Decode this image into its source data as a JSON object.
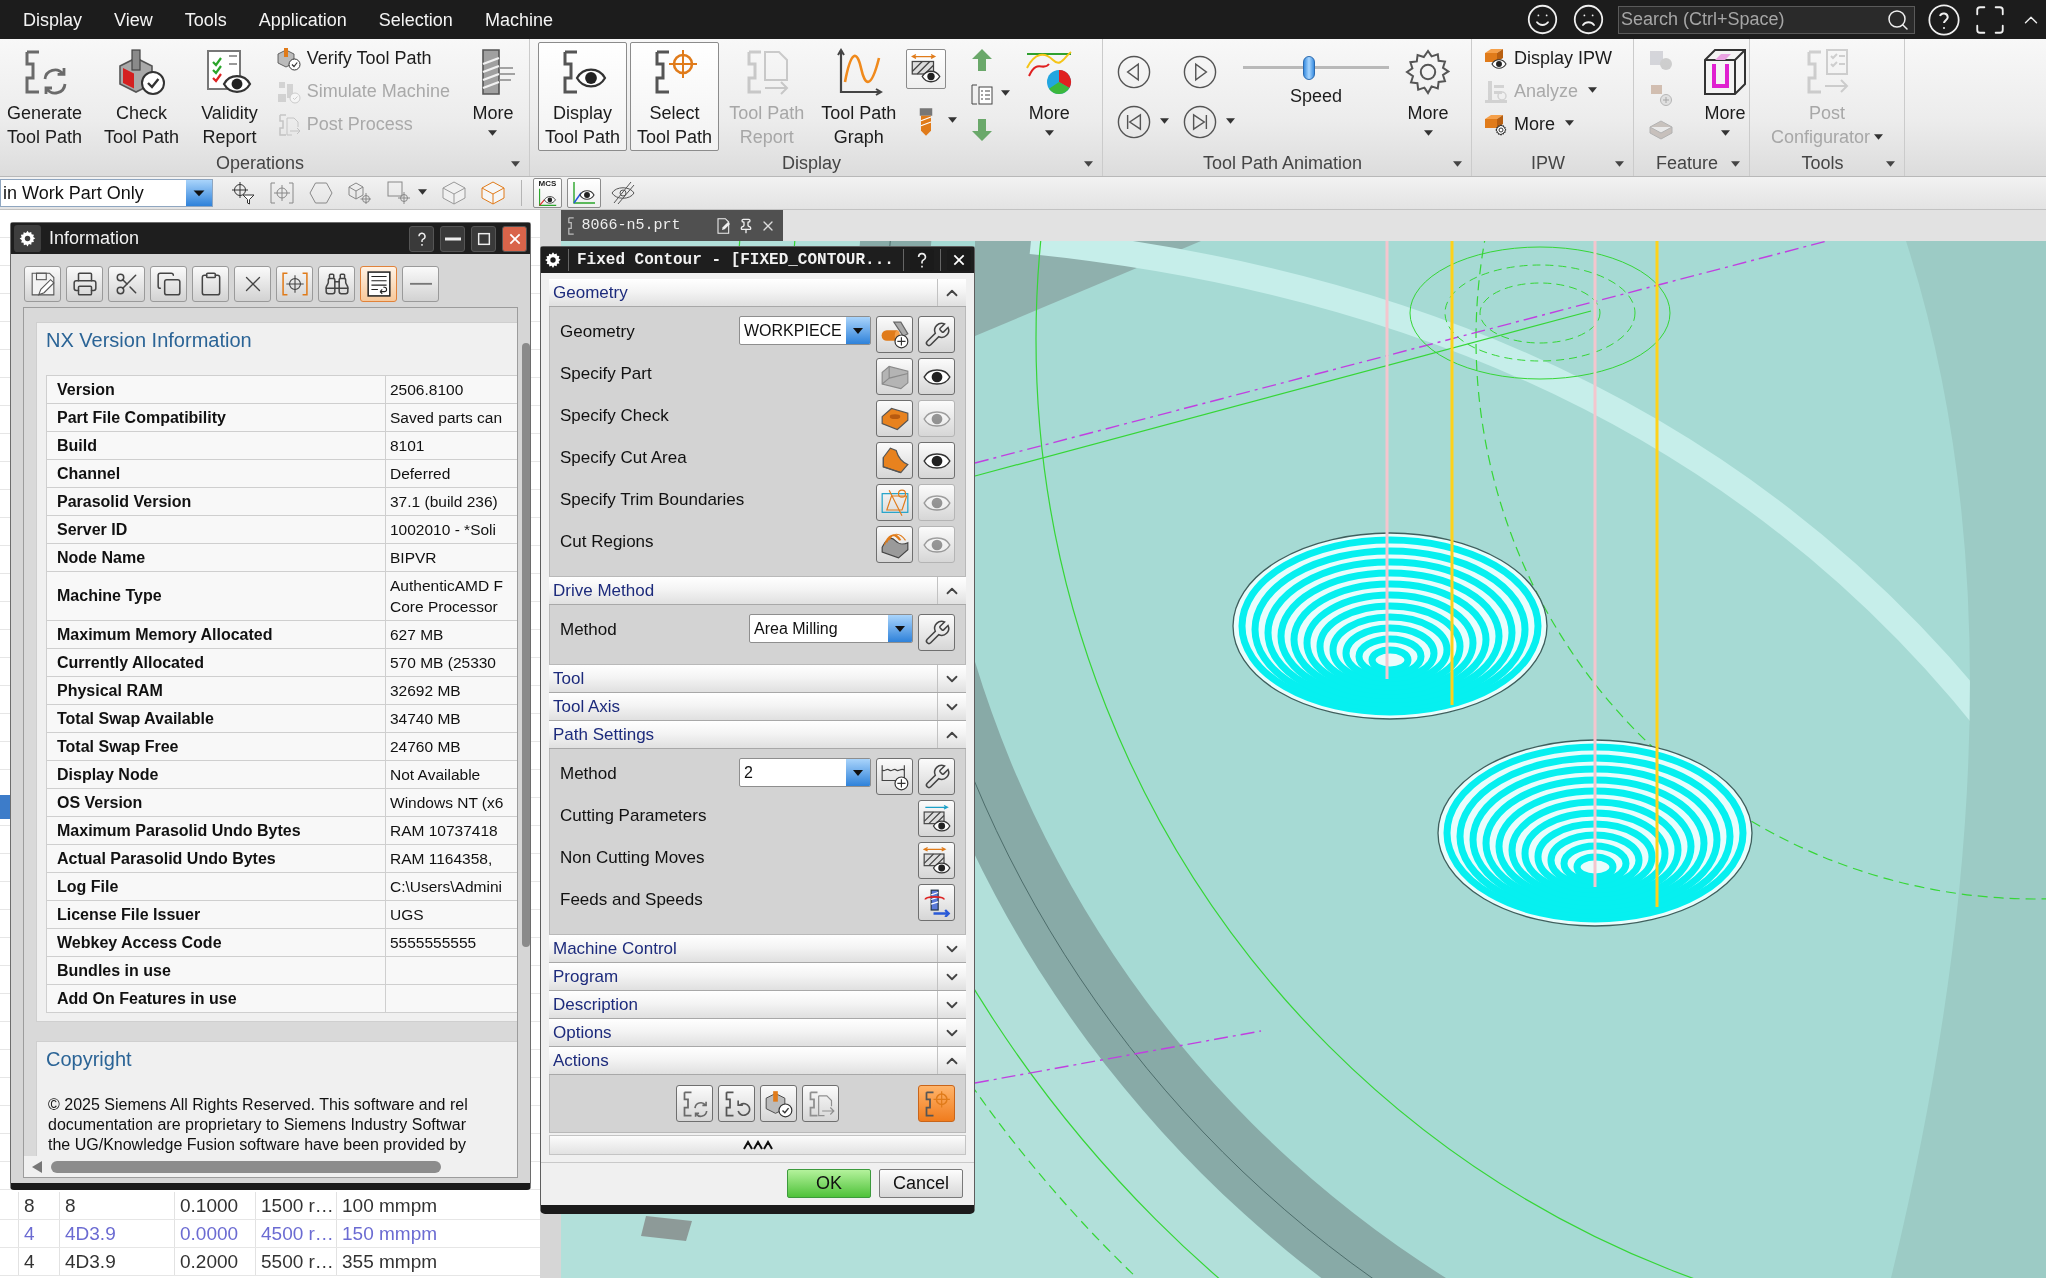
{
  "menu_bar": {
    "items": [
      "Display",
      "View",
      "Tools",
      "Application",
      "Selection",
      "Machine"
    ],
    "search": {
      "placeholder": "Search (Ctrl+Space)"
    }
  },
  "ribbon": {
    "groups": [
      {
        "label": "Operations",
        "items": [
          {
            "kind": "large",
            "label": "Generate\nTool Path",
            "disabled": false,
            "selected": false,
            "dropdown": false
          },
          {
            "kind": "large",
            "label": "Check\nTool Path",
            "disabled": false,
            "selected": false,
            "dropdown": false
          },
          {
            "kind": "large",
            "label": "Validity\nReport",
            "disabled": false,
            "selected": false,
            "dropdown": false
          },
          {
            "kind": "stack",
            "entries": [
              {
                "label": "Verify Tool Path",
                "disabled": false,
                "dropdown": false
              },
              {
                "label": "Simulate Machine",
                "disabled": true,
                "dropdown": false
              },
              {
                "label": "Post Process",
                "disabled": true,
                "dropdown": false
              }
            ]
          },
          {
            "kind": "large",
            "label": "More",
            "disabled": false,
            "selected": false,
            "dropdown": true
          }
        ]
      },
      {
        "label": "Display",
        "items": [
          {
            "kind": "large",
            "label": "Display\nTool Path",
            "disabled": false,
            "selected": true,
            "dropdown": false
          },
          {
            "kind": "large",
            "label": "Select\nTool Path",
            "disabled": false,
            "selected": true,
            "dropdown": false
          },
          {
            "kind": "large",
            "label": "Tool Path\nReport",
            "disabled": true,
            "selected": false,
            "dropdown": false
          },
          {
            "kind": "large",
            "label": "Tool Path\nGraph",
            "disabled": false,
            "selected": false,
            "dropdown": false
          },
          {
            "kind": "icons",
            "buttons": [
              {
                "selected": true,
                "disabled": false,
                "dropdown": false
              },
              {
                "selected": false,
                "disabled": false,
                "dropdown": true
              }
            ]
          },
          {
            "kind": "icons",
            "buttons": [
              {
                "selected": false,
                "disabled": false,
                "dropdown": false
              },
              {
                "selected": false,
                "disabled": false,
                "dropdown": true
              },
              {
                "selected": false,
                "disabled": false,
                "dropdown": false
              }
            ]
          },
          {
            "kind": "large",
            "label": "More",
            "disabled": false,
            "selected": false,
            "dropdown": true
          }
        ]
      },
      {
        "label": "Tool Path Animation",
        "items": [
          {
            "kind": "player",
            "buttons": [
              {
                "dropdown": false
              },
              {
                "dropdown": false
              },
              {
                "dropdown": true
              },
              {
                "dropdown": true
              }
            ]
          },
          {
            "kind": "slider",
            "label": "Speed",
            "level": 0.45
          },
          {
            "kind": "large",
            "label": "More",
            "disabled": false,
            "selected": false,
            "dropdown": true
          }
        ]
      },
      {
        "label": "IPW",
        "items": [
          {
            "kind": "stack",
            "entries": [
              {
                "label": "Display IPW",
                "disabled": false,
                "dropdown": false
              },
              {
                "label": "Analyze",
                "disabled": true,
                "dropdown": true
              },
              {
                "label": "More",
                "disabled": false,
                "dropdown": true
              }
            ]
          }
        ]
      },
      {
        "label": "Feature",
        "items": [
          {
            "kind": "icons",
            "buttons": [
              {
                "selected": false,
                "disabled": true,
                "dropdown": false
              },
              {
                "selected": false,
                "disabled": true,
                "dropdown": false
              },
              {
                "selected": false,
                "disabled": true,
                "dropdown": false
              }
            ]
          },
          {
            "kind": "large",
            "label": "More",
            "disabled": false,
            "selected": false,
            "dropdown": true
          }
        ]
      },
      {
        "label": "Tools",
        "items": [
          {
            "kind": "large",
            "label": "Post\nConfigurator",
            "disabled": true,
            "selected": false,
            "dropdown": true
          }
        ]
      }
    ]
  },
  "selection_bar": {
    "filter": {
      "value": "in Work Part Only"
    },
    "tools": [
      {
        "selected": false,
        "dropdown": false
      },
      {
        "selected": false,
        "dropdown": false
      },
      {
        "selected": false,
        "dropdown": false
      },
      {
        "selected": false,
        "dropdown": false
      },
      {
        "selected": false,
        "dropdown": true
      },
      {
        "selected": false,
        "dropdown": false
      },
      {
        "selected": false,
        "dropdown": false
      },
      {
        "selected": true,
        "dropdown": false,
        "label": "MCS"
      },
      {
        "selected": true,
        "dropdown": false
      },
      {
        "selected": false,
        "dropdown": false
      }
    ]
  },
  "navigator": {
    "rows": [
      {
        "cells": [
          "8",
          "8",
          "0.1000",
          "1500 r…",
          "100 mmpm"
        ],
        "current": false
      },
      {
        "cells": [
          "4",
          "4D3.9",
          "0.0000",
          "4500 r…",
          "150 mmpm"
        ],
        "current": true
      },
      {
        "cells": [
          "4",
          "4D3.9",
          "0.2000",
          "5500 r…",
          "355 mmpm"
        ],
        "current": false
      }
    ]
  },
  "graphics": {
    "tab": {
      "label": "8066-n5.prt"
    }
  },
  "information_window": {
    "title": "Information",
    "toolbar": [
      {
        "selected": false
      },
      {
        "selected": false
      },
      {
        "selected": false
      },
      {
        "selected": false
      },
      {
        "selected": false
      },
      {
        "selected": false
      },
      {
        "selected": false
      },
      {
        "selected": false
      },
      {
        "selected": true
      },
      {
        "selected": false
      }
    ],
    "version_section": {
      "heading": "NX Version Information",
      "rows": [
        {
          "label": "Version",
          "value": "2506.8100"
        },
        {
          "label": "Part File Compatibility",
          "value": "Saved parts can"
        },
        {
          "label": "Build",
          "value": "8101"
        },
        {
          "label": "Channel",
          "value": "Deferred"
        },
        {
          "label": "Parasolid Version",
          "value": "37.1 (build 236)"
        },
        {
          "label": "Server ID",
          "value": "1002010 - *Soli"
        },
        {
          "label": "Node Name",
          "value": "BIPVR"
        },
        {
          "label": "Machine Type",
          "value": "AuthenticAMD F\nCore Processor"
        },
        {
          "label": "Maximum Memory Allocated",
          "value": "627 MB"
        },
        {
          "label": "Currently Allocated",
          "value": "570 MB (25330"
        },
        {
          "label": "Physical RAM",
          "value": "32692 MB"
        },
        {
          "label": "Total Swap Available",
          "value": "34740 MB"
        },
        {
          "label": "Total Swap Free",
          "value": "24760 MB"
        },
        {
          "label": "Display Node",
          "value": "Not Available"
        },
        {
          "label": "OS Version",
          "value": "Windows NT (x6"
        },
        {
          "label": "Maximum Parasolid Undo Bytes",
          "value": "RAM 10737418"
        },
        {
          "label": "Actual Parasolid Undo Bytes",
          "value": "RAM 1164358,"
        },
        {
          "label": "Log File",
          "value": "C:\\Users\\Admini"
        },
        {
          "label": "License File Issuer",
          "value": "UGS"
        },
        {
          "label": "Webkey Access Code",
          "value": "5555555555"
        },
        {
          "label": "Bundles in use"
        },
        {
          "label": "Add On Features in use"
        }
      ]
    },
    "copyright_section": {
      "heading": "Copyright",
      "text": "© 2025 Siemens All Rights Reserved. This software and rel\ndocumentation are proprietary to Siemens Industry Softwar\nthe UG/Knowledge Fusion software have been provided by"
    }
  },
  "dialog": {
    "title": "Fixed Contour - [FIXED_CONTOUR...",
    "sections": [
      {
        "title": "Geometry",
        "expanded": true,
        "rows": [
          {
            "kind": "select",
            "label": "Geometry",
            "value": "WORKPIECE"
          },
          {
            "kind": "specify",
            "label": "Specify Part",
            "display_enabled": true
          },
          {
            "kind": "specify",
            "label": "Specify Check",
            "display_enabled": false
          },
          {
            "kind": "specify",
            "label": "Specify Cut Area",
            "display_enabled": true
          },
          {
            "kind": "specify",
            "label": "Specify Trim Boundaries",
            "display_enabled": false
          },
          {
            "kind": "specify",
            "label": "Cut Regions",
            "display_enabled": false
          }
        ]
      },
      {
        "title": "Drive Method",
        "expanded": true,
        "rows": [
          {
            "kind": "select",
            "label": "Method",
            "value": "Area Milling"
          }
        ]
      },
      {
        "title": "Tool",
        "expanded": false
      },
      {
        "title": "Tool Axis",
        "expanded": false
      },
      {
        "title": "Path Settings",
        "expanded": true,
        "rows": [
          {
            "kind": "select",
            "label": "Method",
            "value": "2"
          },
          {
            "kind": "action",
            "label": "Cutting Parameters"
          },
          {
            "kind": "action",
            "label": "Non Cutting Moves"
          },
          {
            "kind": "action",
            "label": "Feeds and Speeds"
          }
        ]
      },
      {
        "title": "Machine Control",
        "expanded": false
      },
      {
        "title": "Program",
        "expanded": false
      },
      {
        "title": "Description",
        "expanded": false
      },
      {
        "title": "Options",
        "expanded": false
      },
      {
        "title": "Actions",
        "expanded": true,
        "actions": [
          {
            "highlighted": false
          },
          {
            "highlighted": false
          },
          {
            "highlighted": false
          },
          {
            "highlighted": false
          },
          {
            "highlighted": true
          }
        ]
      }
    ],
    "buttons": [
      {
        "label": "OK",
        "default": true
      },
      {
        "label": "Cancel",
        "default": false
      }
    ]
  }
}
